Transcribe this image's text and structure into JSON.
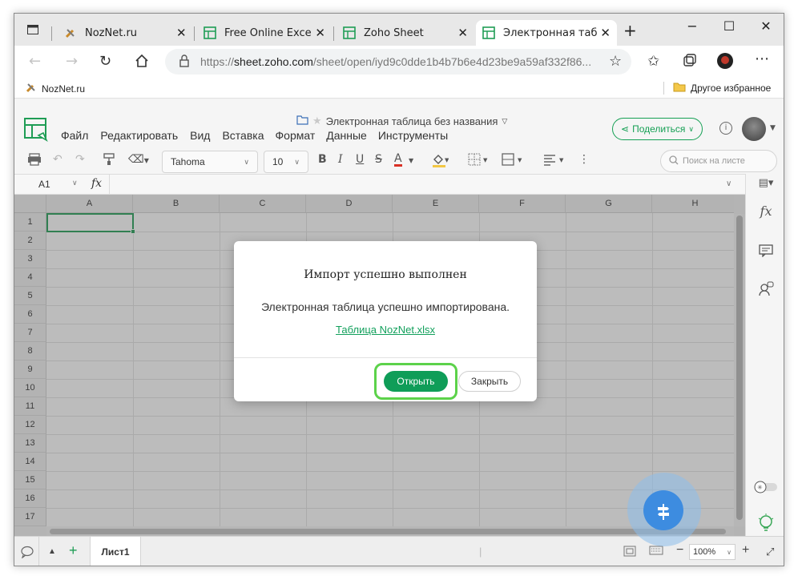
{
  "browser": {
    "tabs": [
      {
        "title": "NozNet.ru",
        "favicon": "tools-icon",
        "active": false
      },
      {
        "title": "Free Online Excel Vie",
        "favicon": "zoho-sheet-icon",
        "active": false
      },
      {
        "title": "Zoho Sheet",
        "favicon": "zoho-sheet-icon",
        "active": false
      },
      {
        "title": "Электронная табли",
        "favicon": "zoho-sheet-icon",
        "active": true
      }
    ],
    "new_tab": "+",
    "window_controls": {
      "minimize": "−",
      "maximize": "☐",
      "close": "✕"
    },
    "url_prefix": "https://",
    "url_host": "sheet.zoho.com",
    "url_path": "/sheet/open/iyd9c0dde1b4b7b6e4d23be9a59af332f86...",
    "bookmarks": {
      "left": "NozNet.ru",
      "right": "Другое избранное"
    }
  },
  "app": {
    "doc_title": "Электронная таблица без названия",
    "menu": [
      "Файл",
      "Редактировать",
      "Вид",
      "Вставка",
      "Формат",
      "Данные",
      "Инструменты"
    ],
    "share_label": "Поделиться",
    "toolbar": {
      "font": "Tahoma",
      "font_size": "10",
      "bold": "B",
      "italic": "I",
      "underline": "U",
      "strike": "S",
      "font_color": "A",
      "search_placeholder": "Поиск на листе"
    },
    "cell_ref": "A1",
    "fx": "fx",
    "columns": [
      "A",
      "B",
      "C",
      "D",
      "E",
      "F",
      "G",
      "H"
    ],
    "rows": [
      "1",
      "2",
      "3",
      "4",
      "5",
      "6",
      "7",
      "8",
      "9",
      "10",
      "11",
      "12",
      "13",
      "14",
      "15",
      "16",
      "17"
    ],
    "sheet_tab": "Лист1",
    "zoom": "100%",
    "zoom_minus": "−",
    "zoom_plus": "+"
  },
  "dialog": {
    "title": "Импорт успешно выполнен",
    "message": "Электронная таблица успешно импортирована.",
    "link": "Таблица NozNet.xlsx",
    "open_button": "Открыть",
    "close_button": "Закрыть"
  },
  "colors": {
    "accent": "#0f9d58",
    "highlight": "#5cd24a",
    "fab": "#3d8ce0"
  }
}
